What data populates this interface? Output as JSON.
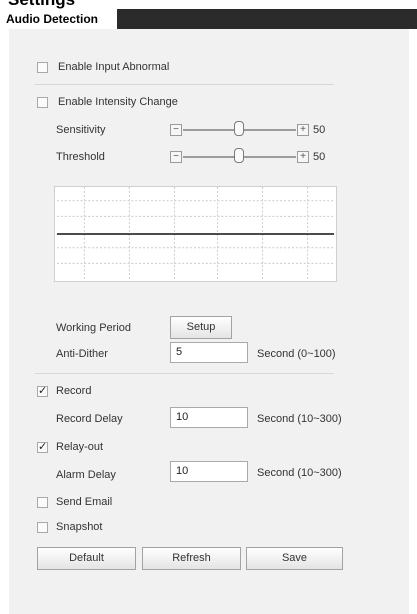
{
  "top_text": "Settings",
  "tab": {
    "label": "Audio Detection"
  },
  "input_abnormal": {
    "label": "Enable Input Abnormal",
    "checked": false
  },
  "intensity_change": {
    "label": "Enable Intensity Change",
    "checked": false
  },
  "sensitivity": {
    "label": "Sensitivity",
    "value": "50",
    "minus": "−",
    "plus": "+"
  },
  "threshold": {
    "label": "Threshold",
    "value": "50",
    "minus": "−",
    "plus": "+"
  },
  "working_period": {
    "label": "Working Period",
    "button": "Setup"
  },
  "anti_dither": {
    "label": "Anti-Dither",
    "value": "5",
    "unit": "Second (0~100)"
  },
  "record": {
    "label": "Record",
    "checked": true
  },
  "record_delay": {
    "label": "Record Delay",
    "value": "10",
    "unit": "Second (10~300)"
  },
  "relay_out": {
    "label": "Relay-out",
    "checked": true
  },
  "alarm_delay": {
    "label": "Alarm Delay",
    "value": "10",
    "unit": "Second (10~300)"
  },
  "send_email": {
    "label": "Send Email",
    "checked": false
  },
  "snapshot": {
    "label": "Snapshot",
    "checked": false
  },
  "buttons": {
    "default": "Default",
    "refresh": "Refresh",
    "save": "Save"
  }
}
